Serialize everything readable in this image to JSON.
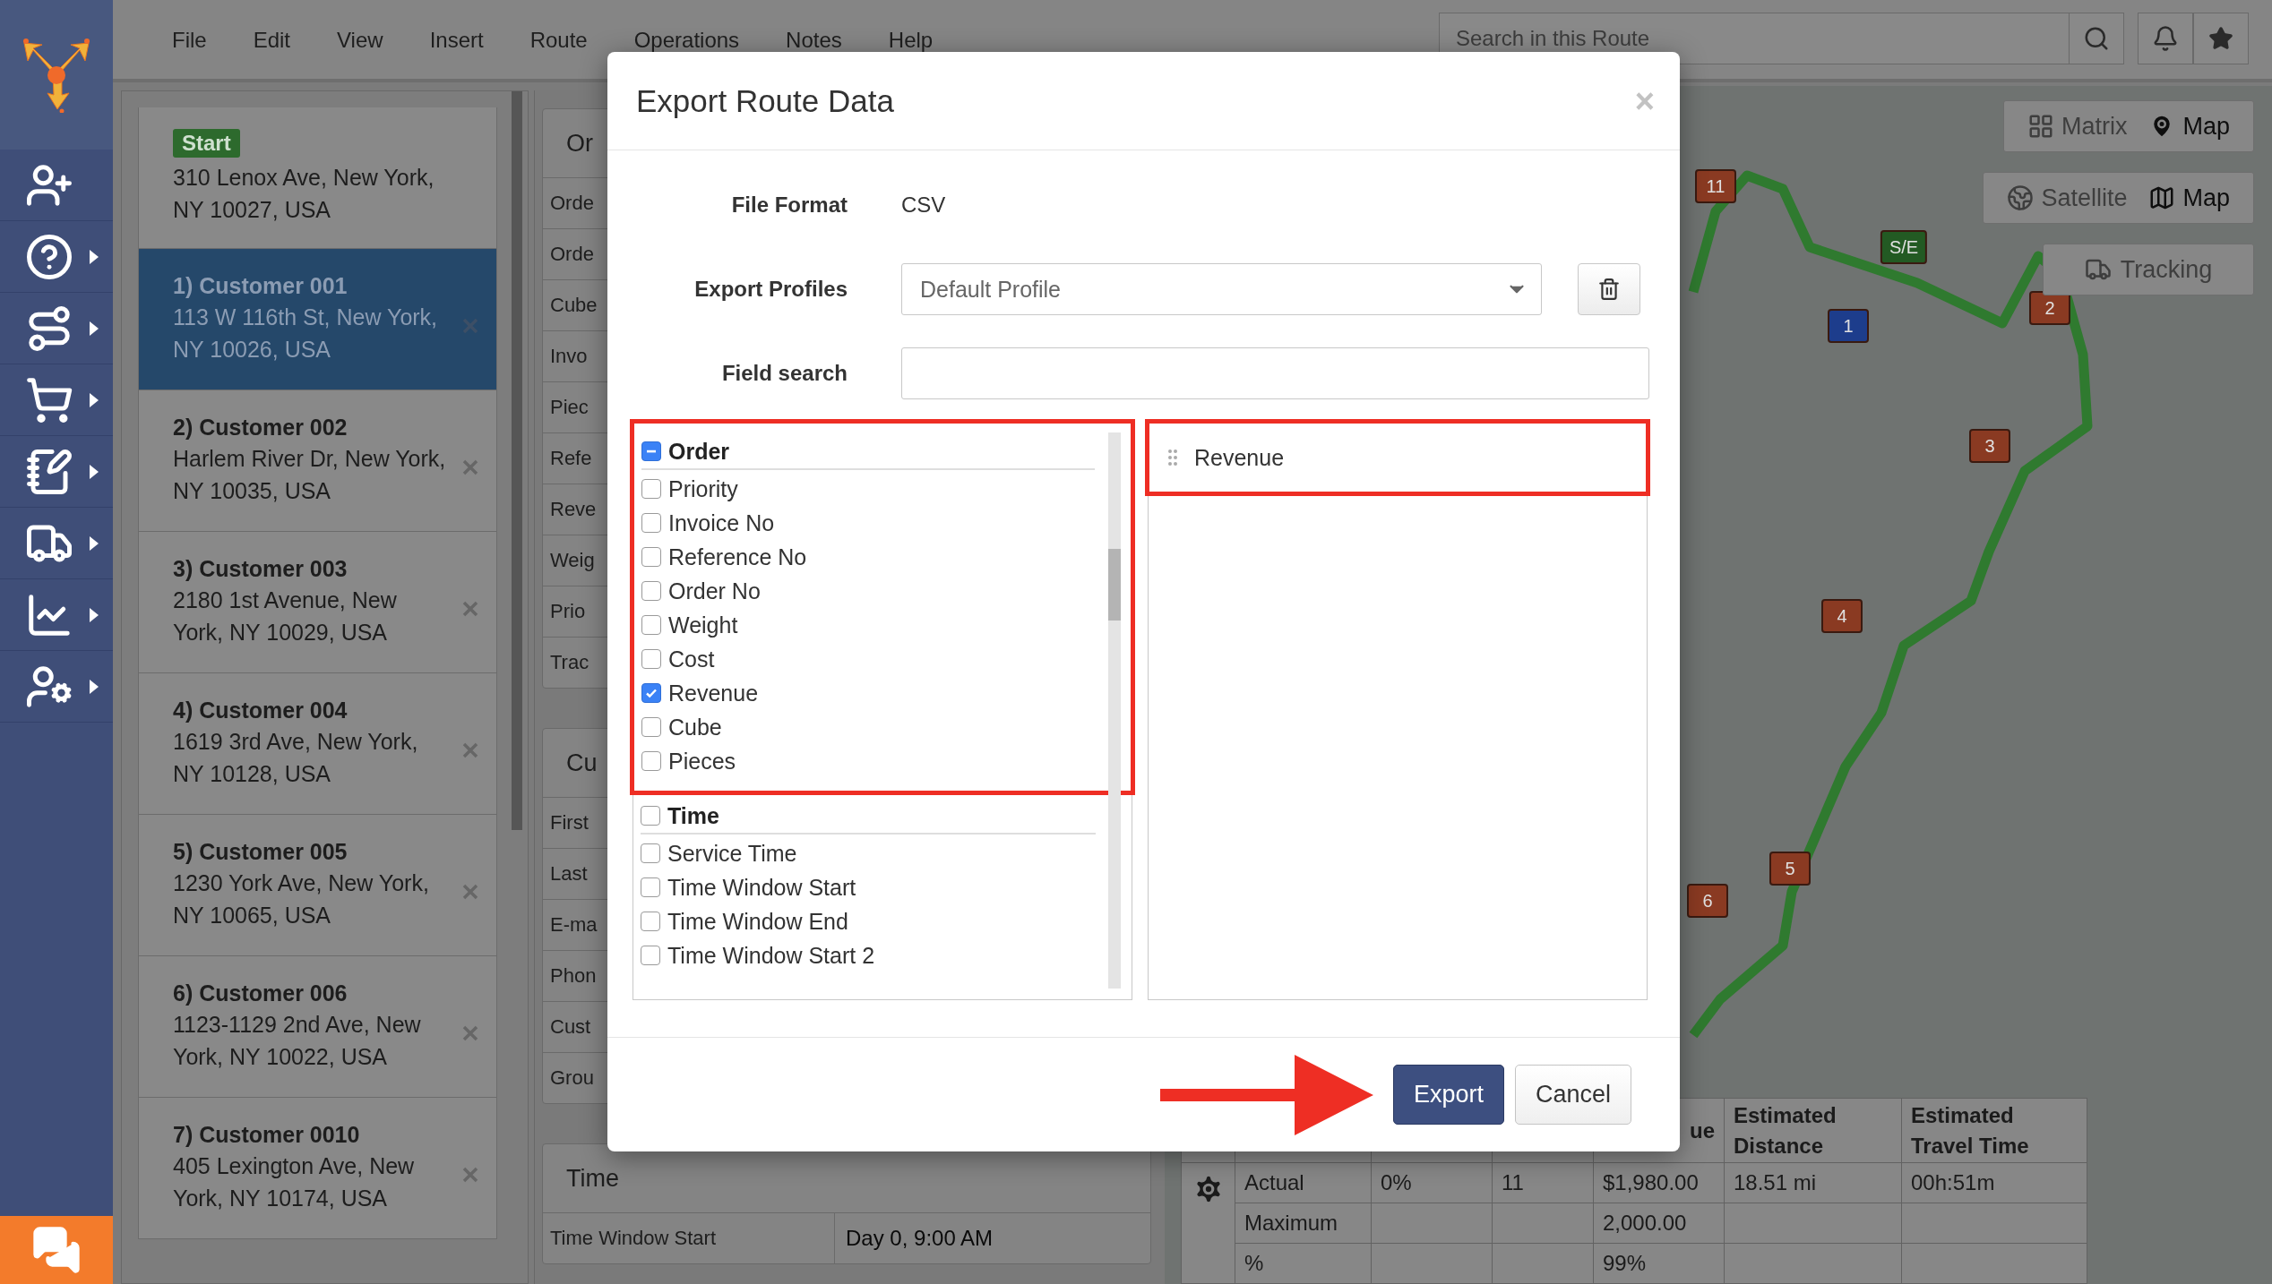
{
  "sidebar": {
    "items": [
      {
        "expandable": false
      },
      {
        "expandable": true
      },
      {
        "expandable": true
      },
      {
        "expandable": true
      },
      {
        "expandable": true
      },
      {
        "expandable": true
      },
      {
        "expandable": true
      },
      {
        "expandable": true
      }
    ]
  },
  "menu": [
    "File",
    "Edit",
    "View",
    "Insert",
    "Route",
    "Operations",
    "Notes",
    "Help"
  ],
  "search": {
    "placeholder": "Search in this Route"
  },
  "stops": [
    {
      "kind": "start",
      "badge": "Start",
      "address": "310 Lenox Ave, New York, NY 10027, USA",
      "selected": false
    },
    {
      "kind": "stop",
      "name": "1) Customer 001",
      "address": "113 W 116th St, New York, NY 10026, USA",
      "selected": true
    },
    {
      "kind": "stop",
      "name": "2) Customer 002",
      "address": "Harlem River Dr, New York, NY 10035, USA",
      "selected": false
    },
    {
      "kind": "stop",
      "name": "3) Customer 003",
      "address": "2180 1st Avenue, New York, NY 10029, USA",
      "selected": false
    },
    {
      "kind": "stop",
      "name": "4) Customer 004",
      "address": "1619 3rd Ave, New York, NY 10128, USA",
      "selected": false
    },
    {
      "kind": "stop",
      "name": "5) Customer 005",
      "address": "1230 York Ave, New York, NY 10065, USA",
      "selected": false
    },
    {
      "kind": "stop",
      "name": "6) Customer 006",
      "address": "1123-1129 2nd Ave, New York, NY 10022, USA",
      "selected": false
    },
    {
      "kind": "stop",
      "name": "7) Customer 0010",
      "address": "405 Lexington Ave, New York, NY 10174, USA",
      "selected": false
    }
  ],
  "details": {
    "sections": [
      {
        "title": "Or",
        "rows": [
          {
            "label": "Orde"
          },
          {
            "label": "Orde"
          },
          {
            "label": "Cube"
          },
          {
            "label": "Invo"
          },
          {
            "label": "Piec"
          },
          {
            "label": "Refe"
          },
          {
            "label": "Reve"
          },
          {
            "label": "Weig"
          },
          {
            "label": "Prio"
          },
          {
            "label": "Trac"
          }
        ]
      },
      {
        "title": "Cu",
        "rows": [
          {
            "label": "First"
          },
          {
            "label": "Last"
          },
          {
            "label": "E-ma"
          },
          {
            "label": "Phon"
          },
          {
            "label": "Cust"
          },
          {
            "label": "Grou"
          }
        ]
      },
      {
        "title": "Time",
        "rows": [
          {
            "label": "Time Window Start",
            "value": "Day 0, 9:00 AM"
          }
        ]
      }
    ]
  },
  "map": {
    "view_toggle": [
      {
        "label": "Matrix",
        "selected": false
      },
      {
        "label": "Map",
        "selected": true
      }
    ],
    "layer_toggle": [
      {
        "label": "Satellite",
        "selected": false
      },
      {
        "label": "Map",
        "selected": true
      }
    ],
    "tracking": "Tracking",
    "markers": [
      {
        "label": "11",
        "color": "#8a3a22"
      },
      {
        "label": "S/E",
        "color": "#235a23"
      },
      {
        "label": "1",
        "color": "#1d3d8c"
      },
      {
        "label": "2",
        "color": "#8a3a22"
      },
      {
        "label": "3",
        "color": "#8a3a22"
      },
      {
        "label": "4",
        "color": "#8a3a22"
      },
      {
        "label": "5",
        "color": "#8a3a22"
      },
      {
        "label": "6",
        "color": "#8a3a22"
      }
    ]
  },
  "summary_table": {
    "headers": [
      "ue",
      "Estimated Distance",
      "Estimated Travel Time"
    ],
    "rows": [
      [
        "Actual",
        "0%",
        "11",
        "$1,980.00",
        "18.51 mi",
        "00h:51m"
      ],
      [
        "Maximum",
        null,
        null,
        "2,000.00",
        null,
        null
      ],
      [
        "%",
        null,
        null,
        "99%",
        null,
        null
      ]
    ]
  },
  "dialog": {
    "title": "Export Route Data",
    "close": "×",
    "fields": [
      {
        "kind": "text",
        "label": "File Format",
        "value": "CSV"
      },
      {
        "kind": "select",
        "label": "Export Profiles",
        "value": "Default Profile"
      },
      {
        "kind": "input",
        "label": "Field search"
      }
    ],
    "available_fields": [
      {
        "group": "Order",
        "checked": false,
        "indeterminate": true,
        "highlighted": true,
        "fields": [
          {
            "label": "Priority",
            "checked": false
          },
          {
            "label": "Invoice No",
            "checked": false
          },
          {
            "label": "Reference No",
            "checked": false
          },
          {
            "label": "Order No",
            "checked": false
          },
          {
            "label": "Weight",
            "checked": false
          },
          {
            "label": "Cost",
            "checked": false
          },
          {
            "label": "Revenue",
            "checked": true
          },
          {
            "label": "Cube",
            "checked": false
          },
          {
            "label": "Pieces",
            "checked": false
          }
        ]
      },
      {
        "group": "Time",
        "checked": false,
        "indeterminate": false,
        "highlighted": false,
        "fields": [
          {
            "label": "Service Time",
            "checked": false
          },
          {
            "label": "Time Window Start",
            "checked": false
          },
          {
            "label": "Time Window End",
            "checked": false
          },
          {
            "label": "Time Window Start 2",
            "checked": false
          }
        ]
      }
    ],
    "selected_fields": [
      {
        "label": "Revenue",
        "highlighted": true
      }
    ],
    "buttons": [
      {
        "kind": "primary",
        "label": "Export"
      },
      {
        "kind": "secondary",
        "label": "Cancel"
      }
    ]
  }
}
